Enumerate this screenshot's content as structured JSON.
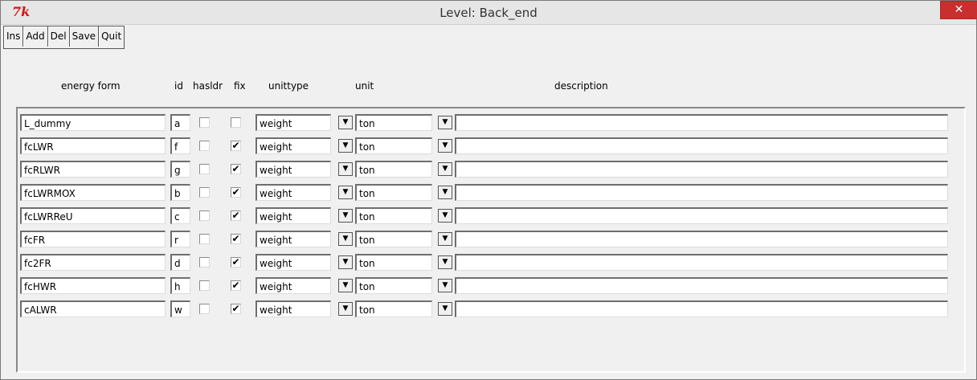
{
  "window": {
    "title": "Level: Back_end",
    "close_label": "✕",
    "icon_label": "7k"
  },
  "toolbar": {
    "buttons": [
      "Ins",
      "Add",
      "Del",
      "Save",
      "Quit"
    ]
  },
  "headers": {
    "energy_form": "energy form",
    "id": "id",
    "hasldr": "hasldr",
    "fix": "fix",
    "unittype": "unittype",
    "unit": "unit",
    "description": "description"
  },
  "rows": [
    {
      "name": "L_dummy",
      "id": "a",
      "hasldr": false,
      "fix": false,
      "unittype": "weight",
      "unit": "ton",
      "description": ""
    },
    {
      "name": "fcLWR",
      "id": "f",
      "hasldr": false,
      "fix": true,
      "unittype": "weight",
      "unit": "ton",
      "description": ""
    },
    {
      "name": "fcRLWR",
      "id": "g",
      "hasldr": false,
      "fix": true,
      "unittype": "weight",
      "unit": "ton",
      "description": ""
    },
    {
      "name": "fcLWRMOX",
      "id": "b",
      "hasldr": false,
      "fix": true,
      "unittype": "weight",
      "unit": "ton",
      "description": ""
    },
    {
      "name": "fcLWRReU",
      "id": "c",
      "hasldr": false,
      "fix": true,
      "unittype": "weight",
      "unit": "ton",
      "description": ""
    },
    {
      "name": "fcFR",
      "id": "r",
      "hasldr": false,
      "fix": true,
      "unittype": "weight",
      "unit": "ton",
      "description": ""
    },
    {
      "name": "fc2FR",
      "id": "d",
      "hasldr": false,
      "fix": true,
      "unittype": "weight",
      "unit": "ton",
      "description": ""
    },
    {
      "name": "fcHWR",
      "id": "h",
      "hasldr": false,
      "fix": true,
      "unittype": "weight",
      "unit": "ton",
      "description": ""
    },
    {
      "name": "cALWR",
      "id": "w",
      "hasldr": false,
      "fix": true,
      "unittype": "weight",
      "unit": "ton",
      "description": ""
    }
  ],
  "icons": {
    "dropdown": "dropdown-arrow-icon",
    "check": "checkmark-icon",
    "app": "tk-logo-icon",
    "close": "close-icon"
  },
  "colors": {
    "close_button": "#c7302e",
    "title_bar": "#e6e6e6",
    "app_icon": "#dd1111"
  }
}
